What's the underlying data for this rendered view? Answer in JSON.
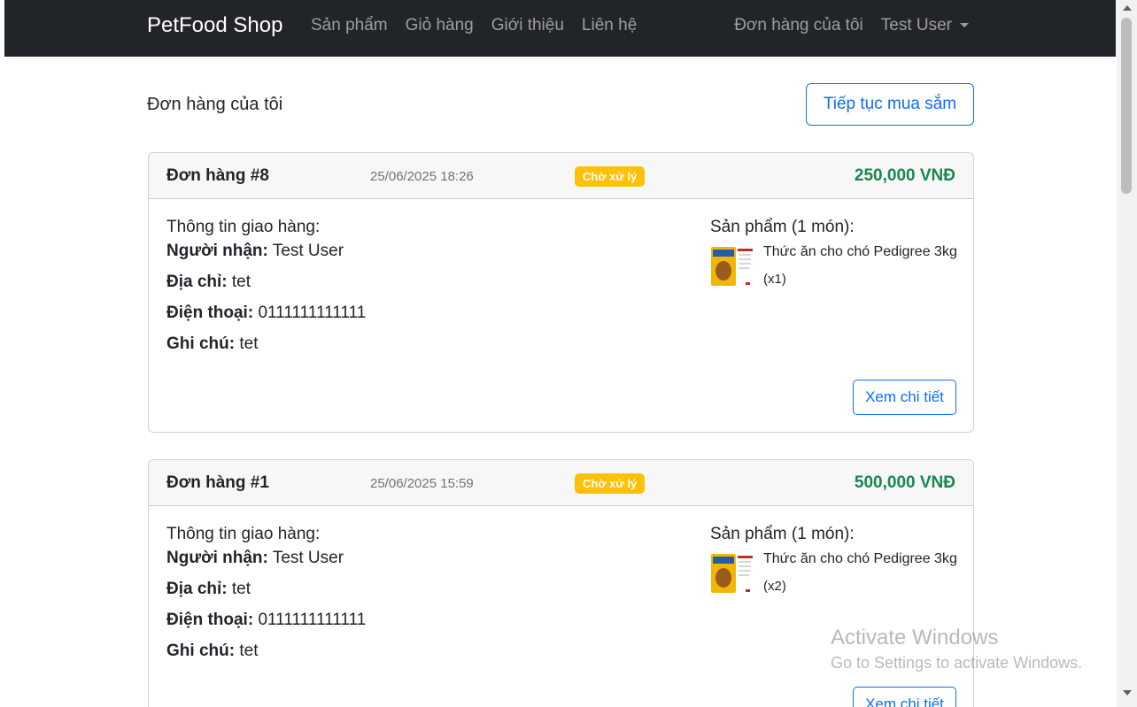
{
  "navbar": {
    "brand": "PetFood Shop",
    "links": [
      "Sản phẩm",
      "Giỏ hàng",
      "Giới thiệu",
      "Liên hệ"
    ],
    "my_orders": "Đơn hàng của tôi",
    "user": "Test User"
  },
  "header": {
    "title": "Đơn hàng của tôi",
    "continue_button": "Tiếp tục mua sắm"
  },
  "orders": [
    {
      "id": "Đơn hàng #8",
      "date": "25/06/2025 18:26",
      "status": "Chờ xử lý",
      "total": "250,000 VNĐ",
      "shipping_heading": "Thông tin giao hàng:",
      "recipient_label": "Người nhận:",
      "recipient": "Test User",
      "address_label": "Địa chỉ:",
      "address": "tet",
      "phone_label": "Điện thoại:",
      "phone": "0111111111111",
      "note_label": "Ghi chú:",
      "note": "tet",
      "products_heading": "Sản phẩm (1 món):",
      "product_name": "Thức ăn cho chó Pedigree 3kg",
      "product_qty": "(x1)",
      "detail_button": "Xem chi tiết"
    },
    {
      "id": "Đơn hàng #1",
      "date": "25/06/2025 15:59",
      "status": "Chờ xử lý",
      "total": "500,000 VNĐ",
      "shipping_heading": "Thông tin giao hàng:",
      "recipient_label": "Người nhận:",
      "recipient": "Test User",
      "address_label": "Địa chỉ:",
      "address": "tet",
      "phone_label": "Điện thoại:",
      "phone": "0111111111111",
      "note_label": "Ghi chú:",
      "note": "tet",
      "products_heading": "Sản phẩm (1 món):",
      "product_name": "Thức ăn cho chó Pedigree 3kg",
      "product_qty": "(x2)",
      "detail_button": "Xem chi tiết"
    }
  ],
  "watermark": {
    "title": "Activate Windows",
    "subtitle": "Go to Settings to activate Windows."
  },
  "colors": {
    "navbar_bg": "#212529",
    "primary": "#0d6efd",
    "success": "#198754",
    "warning": "#ffc107"
  }
}
